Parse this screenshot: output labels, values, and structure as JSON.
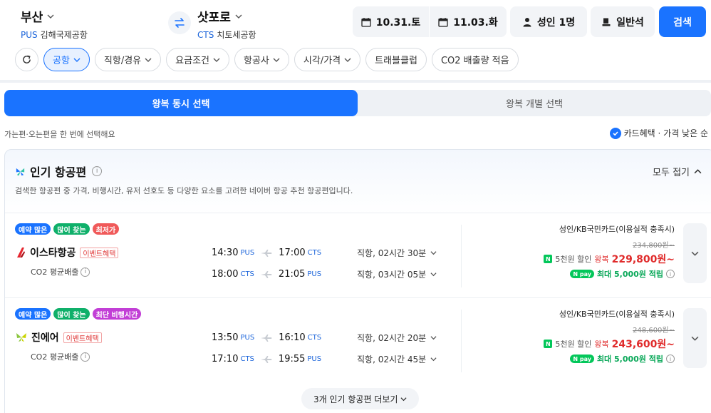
{
  "route": {
    "origin": {
      "city": "부산",
      "code": "PUS",
      "airport": "김해국제공항"
    },
    "destination": {
      "city": "삿포로",
      "code": "CTS",
      "airport": "치토세공항"
    }
  },
  "search": {
    "depart_date": "10.31.토",
    "return_date": "11.03.화",
    "passengers": "성인 1명",
    "cabin": "일반석",
    "search_label": "검색"
  },
  "filters": [
    "공항",
    "직항/경유",
    "요금조건",
    "항공사",
    "시각/가격",
    "트래블클럽",
    "CO2 배출량 적음"
  ],
  "toggle": {
    "together": "왕복 동시 선택",
    "separate": "왕복 개별 선택"
  },
  "info_text": "가는편·오는편을 한 번에 선택해요",
  "sort_label": "카드혜택 · 가격 낮은 순",
  "popular": {
    "title": "인기 항공편",
    "collapse_label": "모두 접기",
    "description": "검색한 항공편 중 가격, 비행시간, 유저 선호도 등 다양한 요소를 고려한 네이버 항공 추천 항공편입니다.",
    "more_label": "3개 인기 항공편 더보기"
  },
  "flights": [
    {
      "tags": [
        {
          "text": "예약 많은",
          "color": "blue"
        },
        {
          "text": "많이 찾는",
          "color": "green"
        },
        {
          "text": "최저가",
          "color": "red"
        }
      ],
      "airline": "이스타항공",
      "event": "이벤트혜택",
      "co2": "CO2 평균배출",
      "outbound": {
        "dep": "14:30",
        "dep_ap": "PUS",
        "arr": "17:00",
        "arr_ap": "CTS",
        "dur": "직항, 02시간 30분"
      },
      "inbound": {
        "dep": "18:00",
        "dep_ap": "CTS",
        "arr": "21:05",
        "arr_ap": "PUS",
        "dur": "직항, 03시간 05분"
      },
      "price": {
        "condition": "성인/KB국민카드(이용실적 충족시)",
        "original": "234,800원~",
        "discount": "5천원 할인",
        "roundtrip": "왕복",
        "amount": "229,800원~",
        "points": "최대 5,000원 적립"
      }
    },
    {
      "tags": [
        {
          "text": "예약 많은",
          "color": "blue"
        },
        {
          "text": "많이 찾는",
          "color": "green"
        },
        {
          "text": "최단 비행시간",
          "color": "purple"
        }
      ],
      "airline": "진에어",
      "event": "이벤트혜택",
      "co2": "CO2 평균배출",
      "outbound": {
        "dep": "13:50",
        "dep_ap": "PUS",
        "arr": "16:10",
        "arr_ap": "CTS",
        "dur": "직항, 02시간 20분"
      },
      "inbound": {
        "dep": "17:10",
        "dep_ap": "CTS",
        "arr": "19:55",
        "arr_ap": "PUS",
        "dur": "직항, 02시간 45분"
      },
      "price": {
        "condition": "성인/KB국민카드(이용실적 충족시)",
        "original": "248,600원~",
        "discount": "5천원 할인",
        "roundtrip": "왕복",
        "amount": "243,600원~",
        "points": "최대 5,000원 적립"
      }
    }
  ],
  "colors": {
    "accent": "#1a73ff",
    "price": "#e02b2b",
    "naver_green": "#03c75a"
  }
}
